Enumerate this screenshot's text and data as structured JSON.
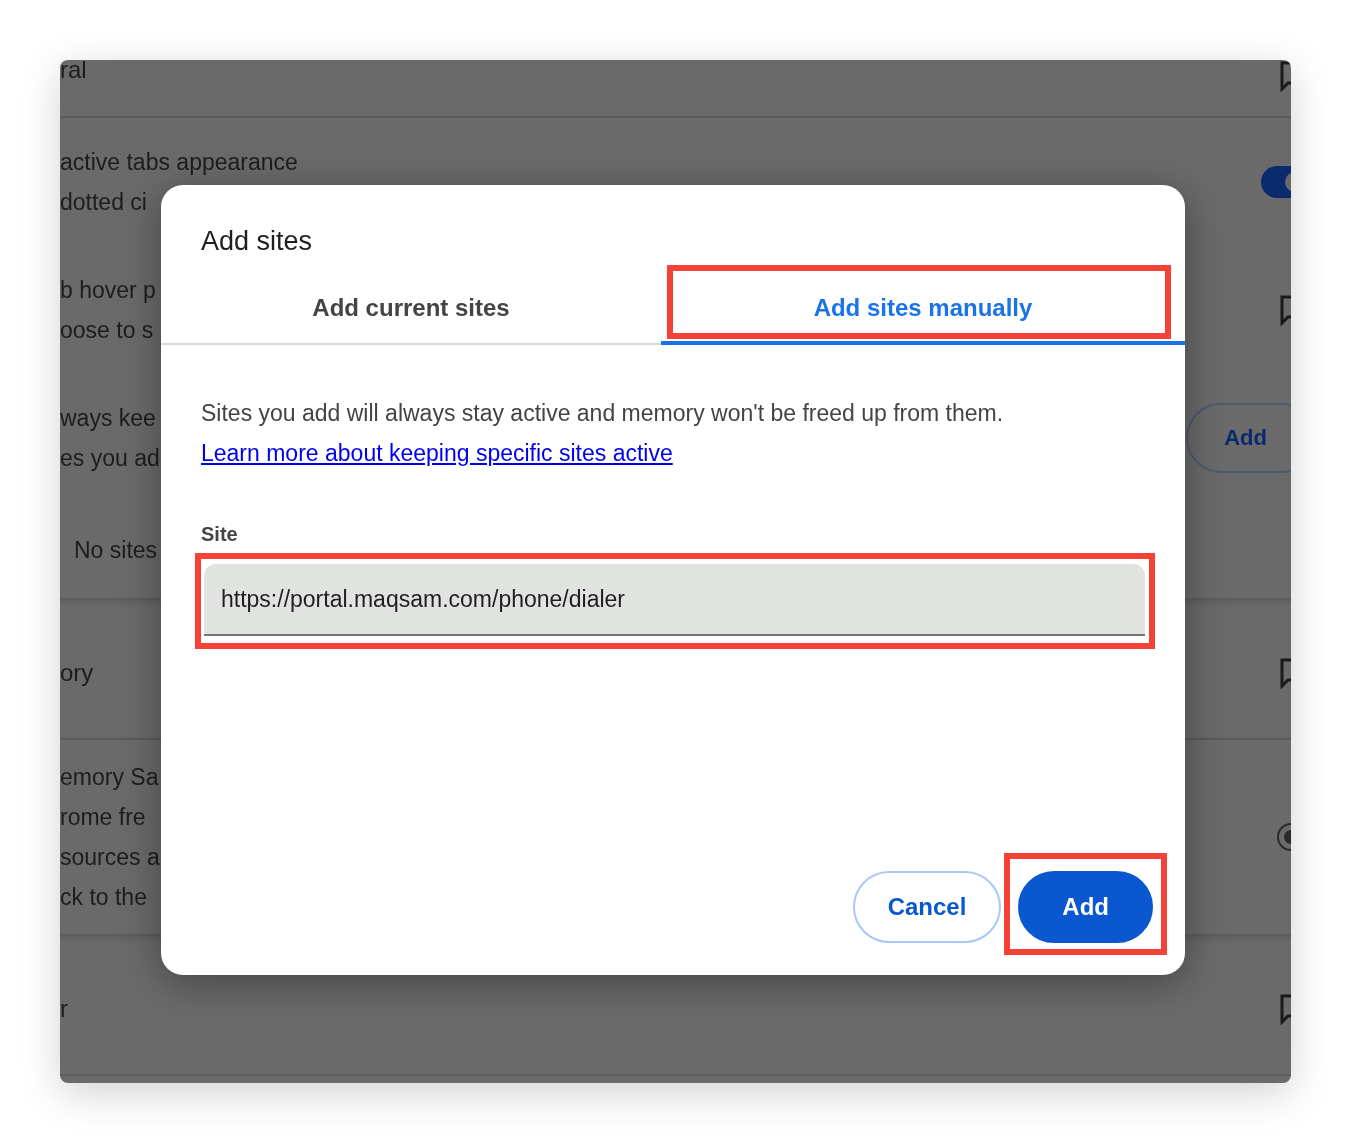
{
  "background": {
    "sections": [
      {
        "kind": "header",
        "title": "ral"
      },
      {
        "kind": "card",
        "rows": [
          {
            "kind": "toggle",
            "lines": [
              "active tabs appearance",
              "dotted ci"
            ],
            "on": true
          },
          {
            "kind": "link",
            "lines": [
              "b hover p",
              "oose to s"
            ]
          },
          {
            "kind": "button",
            "lines": [
              "ways kee",
              "es you ad"
            ],
            "button": "Add"
          },
          {
            "kind": "note",
            "lines": [
              "No sites"
            ]
          }
        ]
      },
      {
        "kind": "header",
        "title": "ory"
      },
      {
        "kind": "card",
        "rows": [
          {
            "kind": "radio",
            "lines": [
              "emory Sa",
              "rome fre",
              "sources a",
              "ck to the"
            ],
            "selected": true
          }
        ]
      },
      {
        "kind": "header",
        "title": "r"
      }
    ]
  },
  "dialog": {
    "title": "Add sites",
    "tabs": [
      {
        "label": "Add current sites",
        "selected": false,
        "highlighted": false
      },
      {
        "label": "Add sites manually",
        "selected": true,
        "highlighted": true
      }
    ],
    "description": "Sites you add will always stay active and memory won't be freed up from them.",
    "link": "Learn more about keeping specific sites active",
    "field": {
      "label": "Site",
      "value": "https://portal.maqsam.com/phone/dialer",
      "highlighted": true
    },
    "buttons": [
      {
        "kind": "secondary",
        "label": "Cancel",
        "highlighted": false
      },
      {
        "kind": "primary",
        "label": "Add",
        "highlighted": true
      }
    ]
  }
}
